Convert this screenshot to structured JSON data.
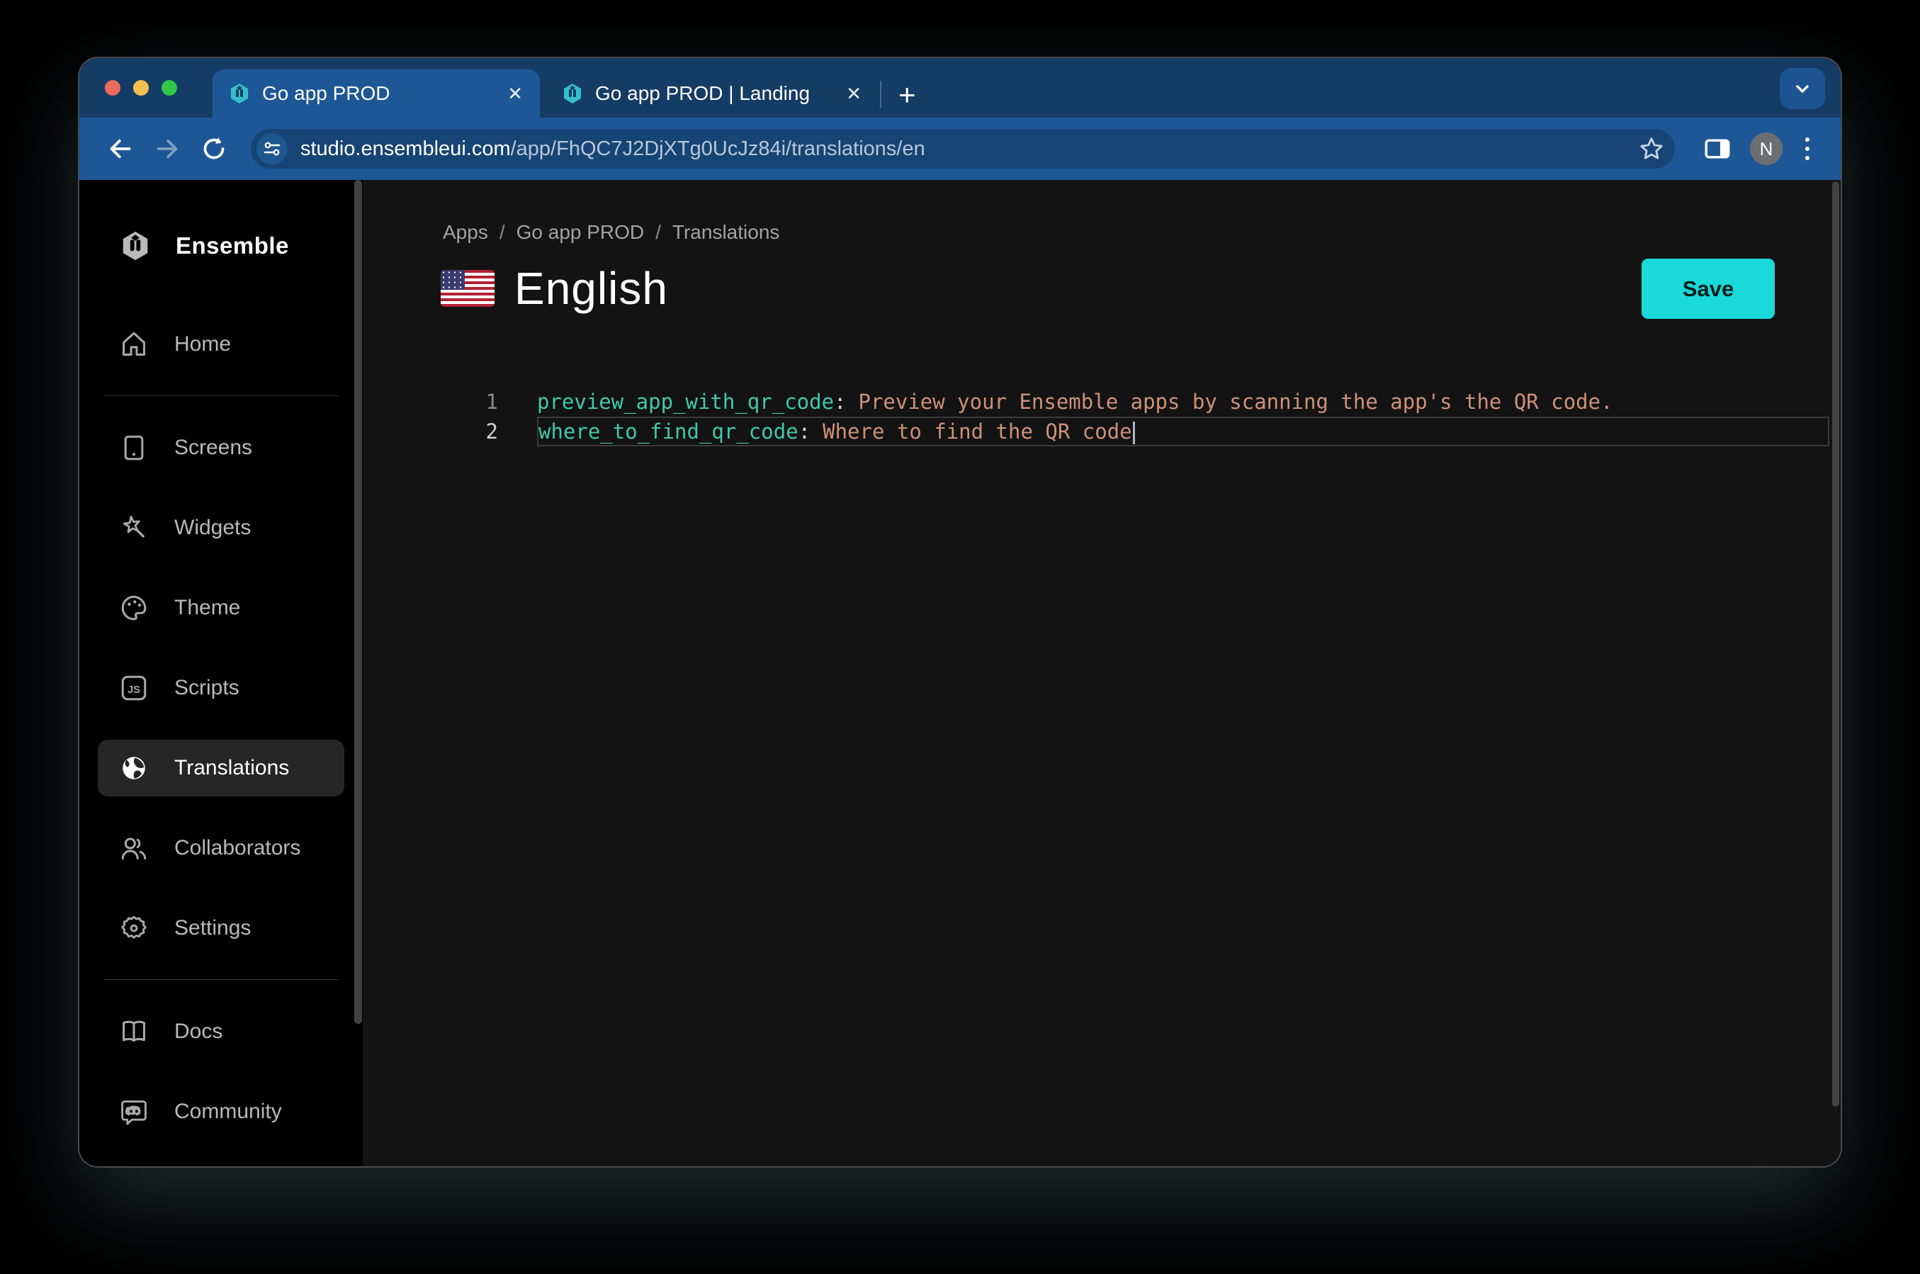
{
  "browser": {
    "tabs": [
      {
        "title": "Go app PROD"
      },
      {
        "title": "Go app PROD | Landing"
      }
    ],
    "close_glyph": "✕",
    "new_tab_glyph": "+",
    "url": {
      "domain": "studio.ensembleui.com",
      "path": "/app/FhQC7J2DjXTg0UcJz84i/translations/en"
    },
    "avatar_letter": "N"
  },
  "sidebar": {
    "brand": "Ensemble",
    "items": [
      {
        "label": "Home",
        "icon": "home-icon",
        "active": false
      },
      {
        "label": "Screens",
        "icon": "screens-icon",
        "active": false
      },
      {
        "label": "Widgets",
        "icon": "widgets-icon",
        "active": false
      },
      {
        "label": "Theme",
        "icon": "theme-icon",
        "active": false
      },
      {
        "label": "Scripts",
        "icon": "scripts-icon",
        "active": false
      },
      {
        "label": "Translations",
        "icon": "globe-icon",
        "active": true
      },
      {
        "label": "Collaborators",
        "icon": "collaborators-icon",
        "active": false
      },
      {
        "label": "Settings",
        "icon": "gear-icon",
        "active": false
      },
      {
        "label": "Docs",
        "icon": "book-icon",
        "active": false
      },
      {
        "label": "Community",
        "icon": "discord-icon",
        "active": false
      }
    ]
  },
  "main": {
    "breadcrumb": {
      "items": [
        "Apps",
        "Go app PROD",
        "Translations"
      ],
      "sep": "/"
    },
    "title": "English",
    "flag": "us-flag",
    "save_label": "Save",
    "editor": {
      "lines": [
        {
          "num": "1",
          "key": "preview_app_with_qr_code",
          "colon": ":",
          "value": "Preview your Ensemble apps by scanning the app's the QR code.",
          "active": false
        },
        {
          "num": "2",
          "key": "where_to_find_qr_code",
          "colon": ":",
          "value": "Where to find the QR code",
          "active": true
        }
      ]
    }
  },
  "colors": {
    "accent": "#19D9D9",
    "chrome_toolbar": "#1E5796",
    "chrome_tabstrip": "#153C64",
    "editor_key": "#42C9A7",
    "editor_value": "#CE9178",
    "active_item_bg": "#262626"
  }
}
